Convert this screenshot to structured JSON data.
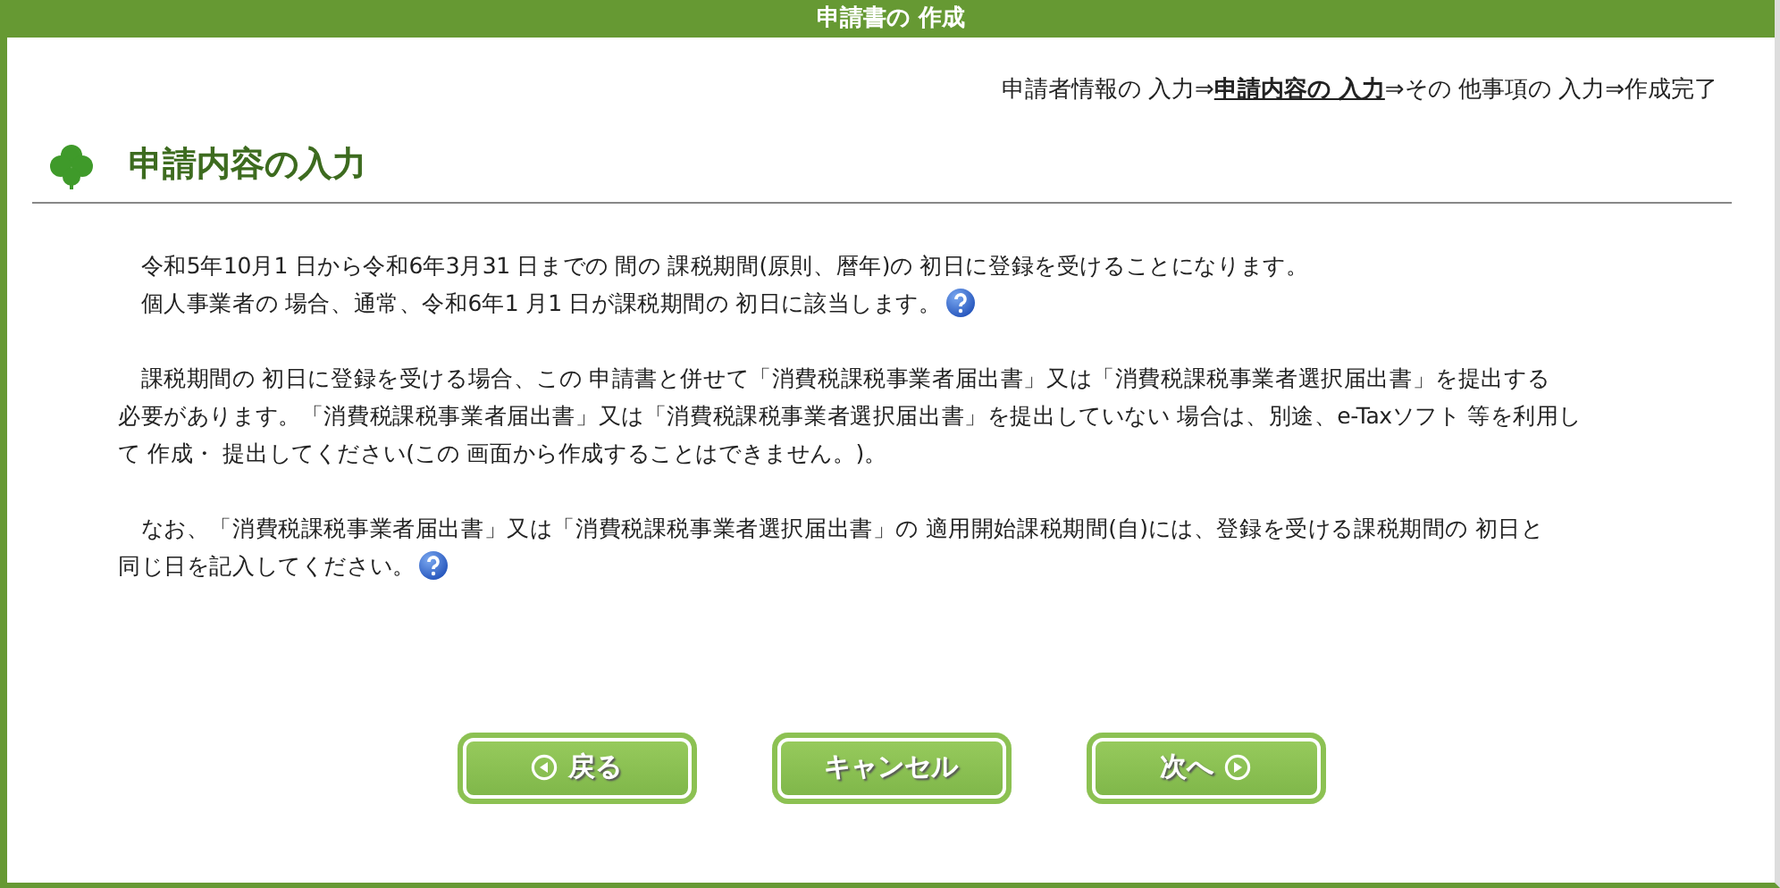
{
  "window": {
    "title": "申請書の 作成"
  },
  "progress": [
    {
      "kind": "step",
      "label": "申請者情報の 入力",
      "selected": false
    },
    {
      "kind": "arrow",
      "label": "⇒"
    },
    {
      "kind": "step",
      "label": "申請内容の 入力",
      "selected": true
    },
    {
      "kind": "arrow",
      "label": "⇒"
    },
    {
      "kind": "step",
      "label": "その 他事項の 入力",
      "selected": false
    },
    {
      "kind": "arrow",
      "label": "⇒"
    },
    {
      "kind": "step",
      "label": "作成完了",
      "selected": false
    }
  ],
  "heading": "申請内容の入力",
  "paragraphs": [
    {
      "lines": [
        {
          "text": "　令和5年10月1 日から令和6年3月31 日までの 間の 課税期間(原則、暦年)の 初日に登録を受けることになります。",
          "help": false
        },
        {
          "text": "　個人事業者の 場合、通常、令和6年1 月1 日が課税期間の 初日に該当します。",
          "help": true
        }
      ]
    },
    {
      "lines": [
        {
          "text": "　課税期間の 初日に登録を受ける場合、この 申請書と併せて「消費税課税事業者届出書」又は「消費税課税事業者選択届出書」を提出する",
          "help": false
        },
        {
          "text": "必要があります。「消費税課税事業者届出書」又は「消費税課税事業者選択届出書」を提出していない 場合は、別途、e-Taxソフト 等を利用し",
          "help": false
        },
        {
          "text": "て 作成・ 提出してください(この 画面から作成することはできません。)。",
          "help": false
        }
      ]
    },
    {
      "lines": [
        {
          "text": "　なお、「消費税課税事業者届出書」又は「消費税課税事業者選択届出書」の 適用開始課税期間(自)には、登録を受ける課税期間の 初日と",
          "help": false
        },
        {
          "text": "同じ日を記入してください。",
          "help": true
        }
      ]
    }
  ],
  "buttons": [
    {
      "kind": "back",
      "label": "戻る"
    },
    {
      "kind": "plain",
      "label": "キャンセル"
    },
    {
      "kind": "next",
      "label": "次へ"
    }
  ]
}
